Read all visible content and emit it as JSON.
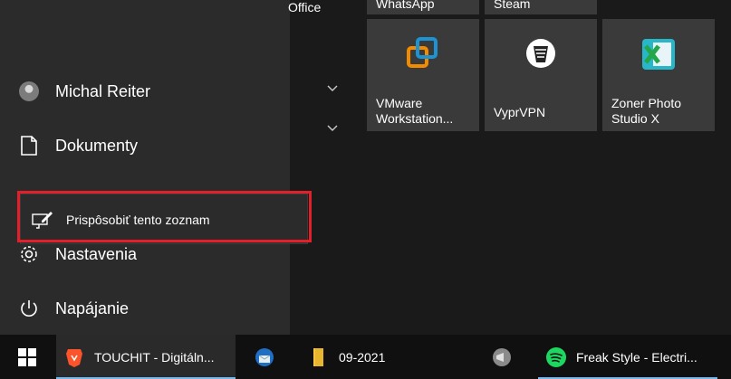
{
  "start_menu": {
    "user_name": "Michal Reiter",
    "documents_label": "Dokumenty",
    "settings_label": "Nastavenia",
    "power_label": "Napájanie"
  },
  "context_menu": {
    "item_label": "Prispôsobiť tento zoznam",
    "highlight_color": "#e3202a"
  },
  "app_list": {
    "partial_label": "Office"
  },
  "tiles": {
    "top_partial": [
      "WhatsApp",
      "Steam"
    ],
    "row": [
      {
        "label": "VMware Workstation...",
        "icon": "vmware-icon"
      },
      {
        "label": "VyprVPN",
        "icon": "vyprvpn-icon"
      },
      {
        "label": "Zoner Photo Studio X",
        "icon": "zoner-icon"
      }
    ]
  },
  "taskbar": {
    "start_icon": "windows-logo-icon",
    "apps": [
      {
        "label": "TOUCHIT - Digitáln...",
        "icon": "brave-icon",
        "active": true
      },
      {
        "label": "",
        "icon": "thunderbird-icon",
        "active": false
      },
      {
        "label": "09-2021",
        "icon": "folder-icon",
        "active": false
      },
      {
        "label": "",
        "icon": "vpn-client-icon",
        "active": false
      },
      {
        "label": "Freak Style - Electri...",
        "icon": "spotify-icon",
        "active": true
      }
    ]
  },
  "colors": {
    "accent": "#76b9ed",
    "tile": "#3a3a3a",
    "rail": "#2b2b2b",
    "taskbar": "#101010"
  }
}
